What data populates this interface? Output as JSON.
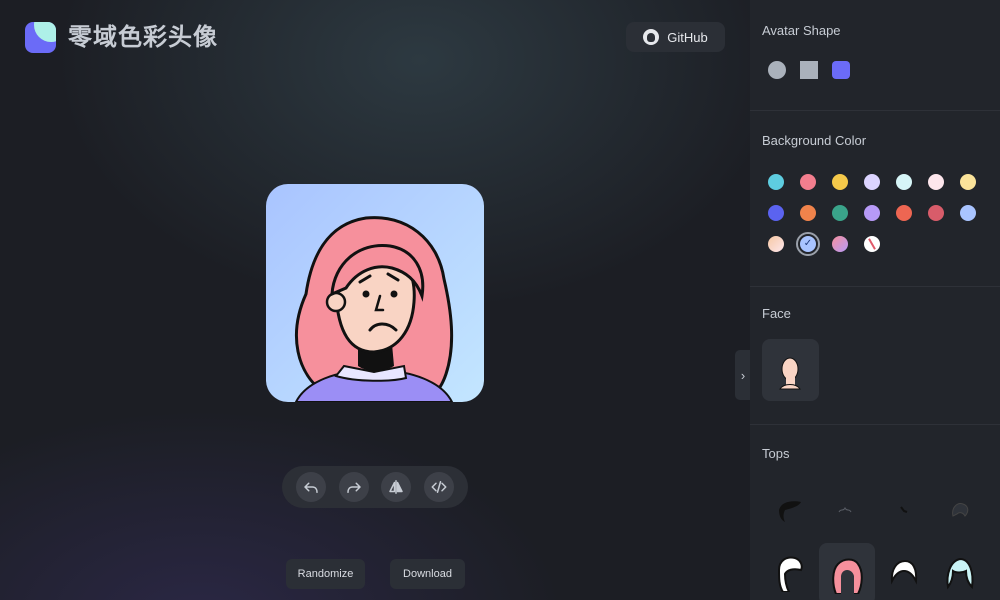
{
  "app": {
    "title": "零域色彩头像"
  },
  "header": {
    "github_label": "GitHub"
  },
  "toolbar": {
    "buttons": [
      "undo",
      "redo",
      "flip",
      "code"
    ]
  },
  "actions": {
    "randomize": "Randomize",
    "download": "Download"
  },
  "sidebar": {
    "avatar_shape": {
      "label": "Avatar Shape",
      "options": [
        "circle",
        "square",
        "squircle"
      ],
      "selected": "squircle"
    },
    "background_color": {
      "label": "Background Color",
      "colors": [
        "#5ecde0",
        "#f37e8e",
        "#f5c94a",
        "#dcd4ff",
        "#d6f5f7",
        "#fde6ec",
        "#fbe39a",
        "#5b63f0",
        "#f0834b",
        "#3aa48a",
        "#b79af7",
        "#ee6652",
        "#d85c6a",
        "#a9c4ff",
        "#f6c8a4",
        "#a9c4ff",
        "#e78fcf",
        "#ffffff"
      ],
      "selected_index": 15
    },
    "face": {
      "label": "Face"
    },
    "tops": {
      "label": "Tops"
    }
  },
  "colors": {
    "accent": "#6b6bf7",
    "hair": "#f6909c",
    "shirt": "#9b8ef5",
    "skin": "#f9d4c4"
  }
}
